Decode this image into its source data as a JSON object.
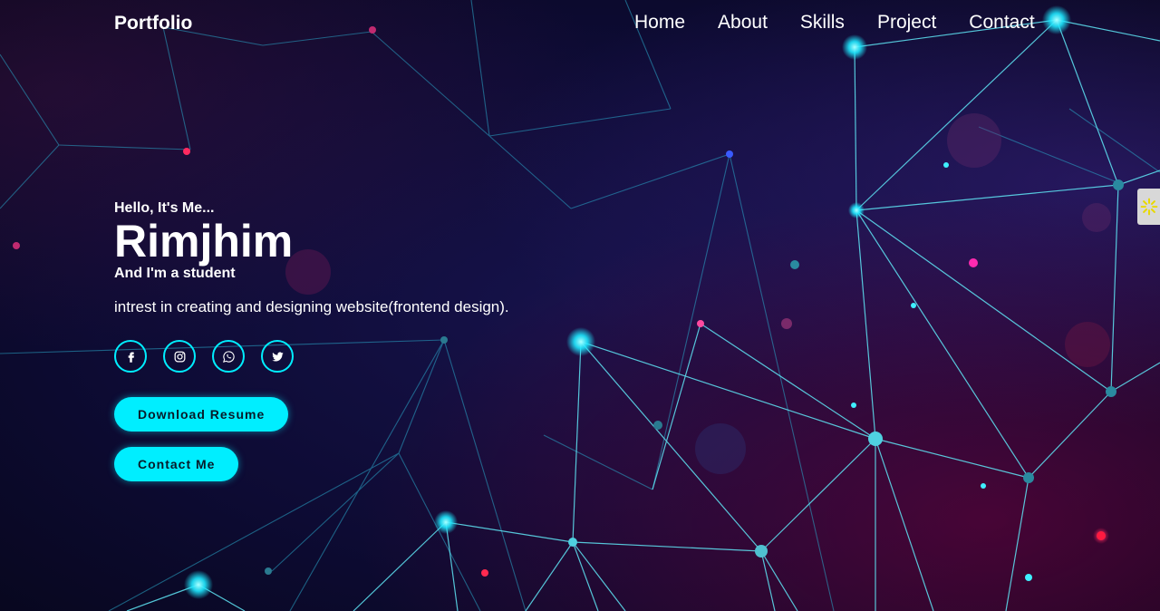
{
  "header": {
    "logo": "Portfolio",
    "nav": [
      "Home",
      "About",
      "Skills",
      "Project",
      "Contact"
    ]
  },
  "hero": {
    "greeting": "Hello, It's Me...",
    "name": "Rimjhim",
    "role": "And I'm a student",
    "description": "intrest in creating and designing website(frontend design).",
    "socials": [
      "facebook-icon",
      "instagram-icon",
      "whatsapp-icon",
      "twitter-icon"
    ],
    "buttons": {
      "resume": "Download Resume",
      "contact": "Contact Me"
    }
  },
  "side_tab": {
    "icon": "settings-icon"
  },
  "colors": {
    "accent": "#00eeff",
    "background": "#0d0b33",
    "button_text": "#081b29"
  }
}
